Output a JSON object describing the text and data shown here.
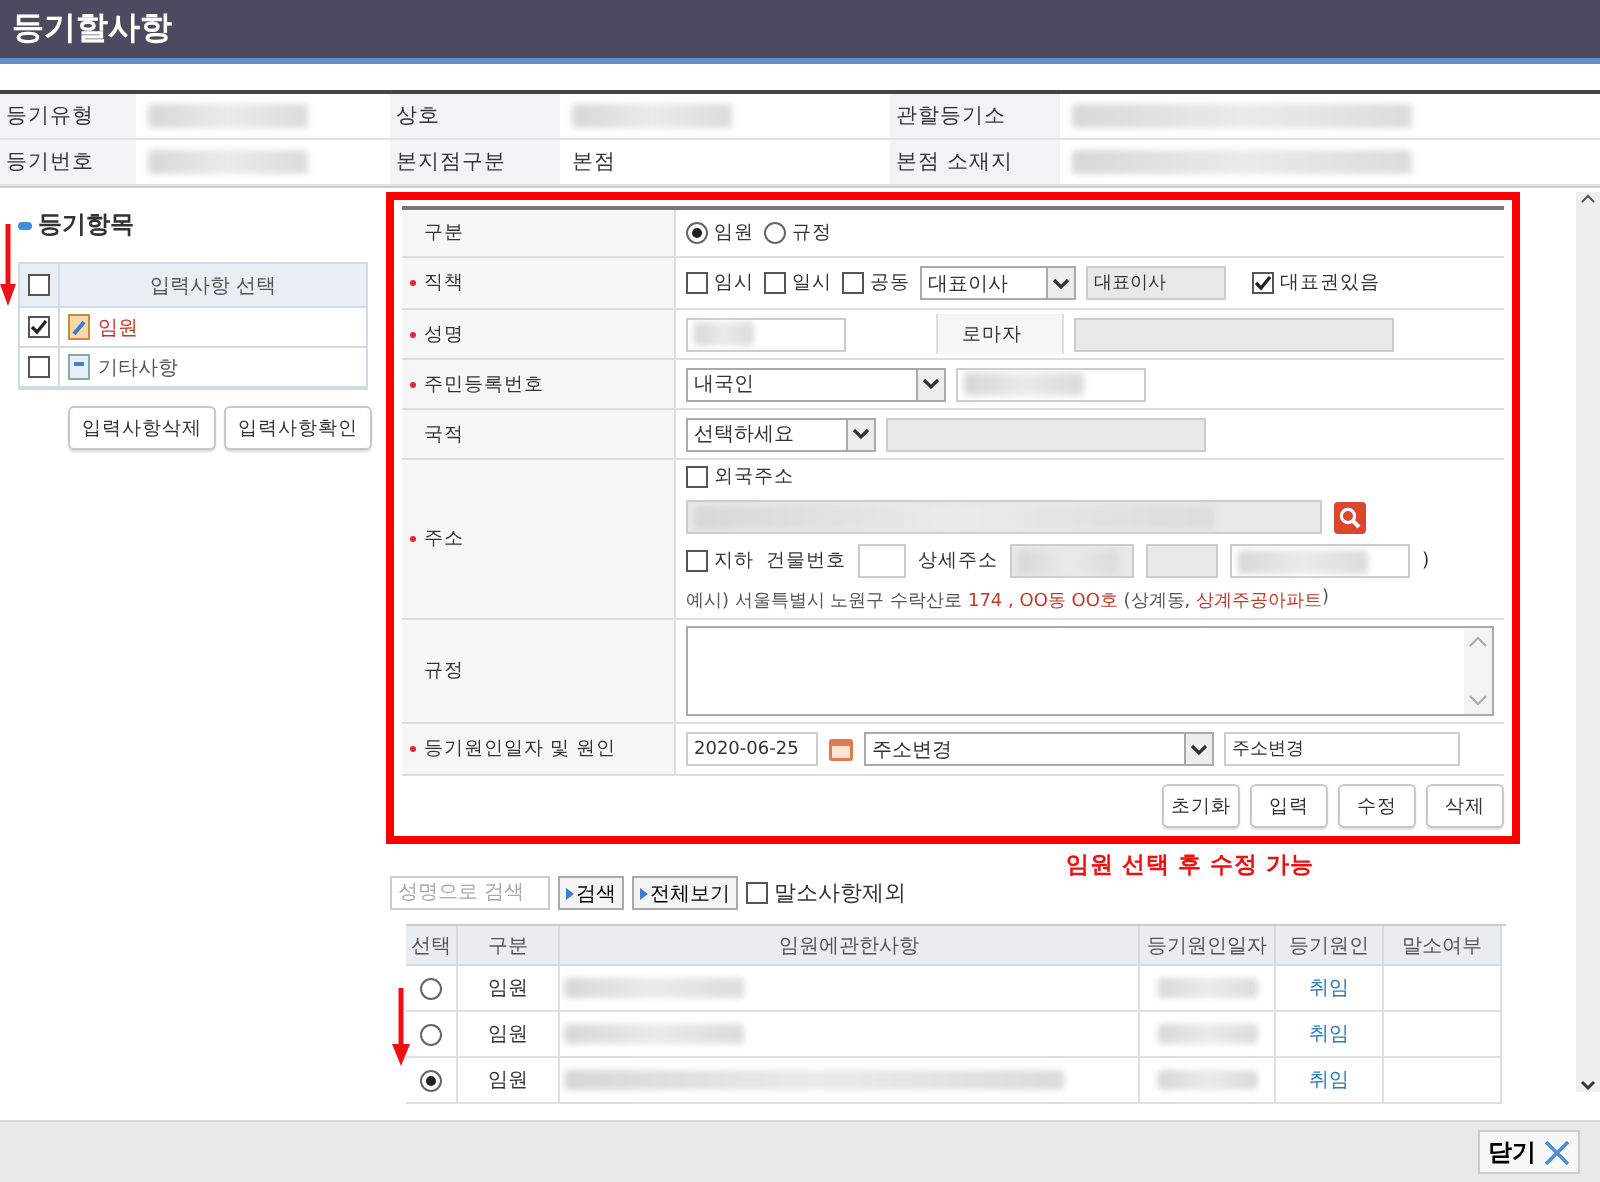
{
  "title": "등기할사항",
  "info_rows": [
    [
      {
        "label": "등기유형",
        "blurred": true
      },
      {
        "label": "상호",
        "blurred": true
      },
      {
        "label": "관할등기소",
        "blurred": true
      }
    ],
    [
      {
        "label": "등기번호",
        "blurred": true
      },
      {
        "label": "본지점구분",
        "value": "본점"
      },
      {
        "label": "본점 소재지",
        "blurred": true
      }
    ]
  ],
  "sidebar": {
    "title": "등기항목",
    "header": "입력사항 선택",
    "header_checked": false,
    "items": [
      {
        "label": "임원",
        "checked": true,
        "kind": "officer"
      },
      {
        "label": "기타사항",
        "checked": false,
        "kind": "other"
      }
    ],
    "buttons": [
      "입력사항삭제",
      "입력사항확인"
    ]
  },
  "form": {
    "rows": [
      {
        "kind": "division",
        "label": "구분",
        "required": false,
        "options": [
          {
            "label": "임원",
            "selected": true
          },
          {
            "label": "규정",
            "selected": false
          }
        ]
      },
      {
        "kind": "position",
        "label": "직책",
        "required": true,
        "checks": [
          {
            "label": "임시",
            "checked": false
          },
          {
            "label": "일시",
            "checked": false
          },
          {
            "label": "공동",
            "checked": false
          }
        ],
        "select": "대표이사",
        "readonly": "대표이사",
        "rep": {
          "label": "대표권있음",
          "checked": true
        }
      },
      {
        "kind": "name",
        "label": "성명",
        "required": true,
        "roman_label": "로마자"
      },
      {
        "kind": "resident",
        "label": "주민등록번호",
        "required": true,
        "select": "내국인"
      },
      {
        "kind": "nationality",
        "label": "국적",
        "required": false,
        "select": "선택하세요"
      },
      {
        "kind": "address",
        "label": "주소",
        "required": true,
        "foreign": {
          "label": "외국주소",
          "checked": false
        },
        "basement": {
          "label": "지하",
          "checked": false
        },
        "building_label": "건물번호",
        "detail_label": "상세주소",
        "close": ")",
        "example": [
          {
            "text": "예시) 서울특별시 노원구 수락산로 ",
            "highlight": false
          },
          {
            "text": "174 , OO동 OO호",
            "highlight": true
          },
          {
            "text": " (상계동, ",
            "highlight": false
          },
          {
            "text": "상계주공아파트",
            "highlight": true
          },
          {
            "text": ")",
            "highlight": false
          }
        ]
      },
      {
        "kind": "rule",
        "label": "규정",
        "required": false
      },
      {
        "kind": "cause",
        "label": "등기원인일자 및 원인",
        "required": true,
        "date": "2020-06-25",
        "select": "주소변경",
        "text": "주소변경"
      }
    ],
    "buttons": [
      "초기화",
      "입력",
      "수정",
      "삭제"
    ]
  },
  "note": "임원 선택 후 수정 가능",
  "search": {
    "placeholder": "성명으로 검색",
    "buttons": [
      "검색",
      "전체보기"
    ],
    "exclude": {
      "label": "말소사항제외",
      "checked": false
    }
  },
  "table": {
    "columns": [
      "선택",
      "구분",
      "임원에관한사항",
      "등기원인일자",
      "등기원인",
      "말소여부"
    ],
    "rows": [
      {
        "selected": false,
        "type": "임원",
        "cause": "취임"
      },
      {
        "selected": false,
        "type": "임원",
        "cause": "취임"
      },
      {
        "selected": true,
        "type": "임원",
        "cause": "취임"
      }
    ]
  },
  "close_button": "닫기"
}
